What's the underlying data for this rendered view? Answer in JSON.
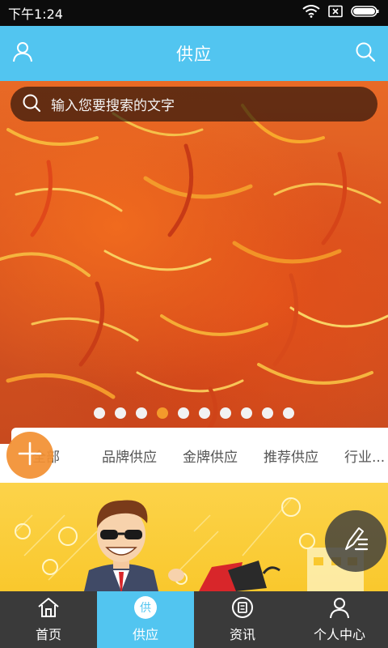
{
  "status_bar": {
    "time": "下午1:24",
    "icons": [
      "wifi-icon",
      "sim-card-icon",
      "battery-icon"
    ]
  },
  "header": {
    "title": "供应",
    "left_icon": "user-icon",
    "right_icon": "search-icon"
  },
  "search": {
    "placeholder": "输入您要搜索的文字",
    "icon": "search-icon"
  },
  "banner": {
    "subject": "safflower",
    "slide_count": 10,
    "active_slide": 4
  },
  "categories": {
    "items": [
      "全部",
      "品牌供应",
      "金牌供应",
      "推荐供应",
      "行业..."
    ],
    "active_index": 0
  },
  "fab_add": {
    "icon": "plus-icon"
  },
  "fab_edit": {
    "icon": "edit-list-icon"
  },
  "bottom_nav": {
    "items": [
      {
        "label": "首页",
        "icon": "home-icon"
      },
      {
        "label": "供应",
        "icon": "supply-badge-icon",
        "badge": "供"
      },
      {
        "label": "资讯",
        "icon": "news-icon"
      },
      {
        "label": "个人中心",
        "icon": "profile-icon"
      }
    ],
    "active_index": 1
  },
  "colors": {
    "accent": "#52c5f0",
    "orange": "#f39133",
    "nav_bg": "#3a3a3a",
    "promo_yellow": "#fcd34a"
  }
}
